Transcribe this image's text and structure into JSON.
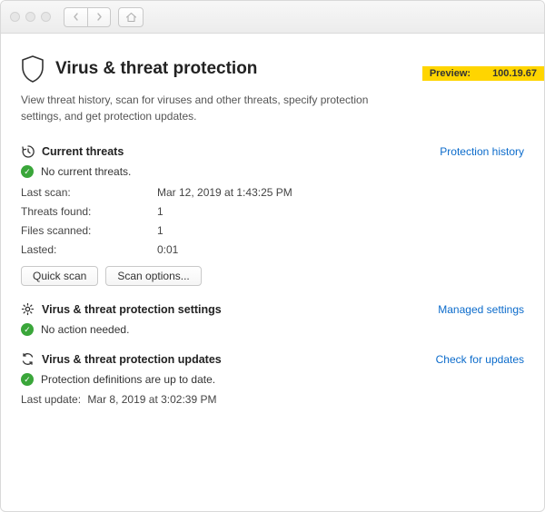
{
  "preview": {
    "label": "Preview:",
    "version": "100.19.67"
  },
  "page": {
    "title": "Virus & threat protection",
    "description": "View threat history, scan for viruses and other threats, specify protection settings, and get protection updates."
  },
  "threats": {
    "heading": "Current threats",
    "link": "Protection history",
    "status": "No current threats.",
    "rows": {
      "last_scan_label": "Last scan:",
      "last_scan_value": "Mar 12, 2019 at 1:43:25 PM",
      "threats_found_label": "Threats found:",
      "threats_found_value": "1",
      "files_scanned_label": "Files scanned:",
      "files_scanned_value": "1",
      "lasted_label": "Lasted:",
      "lasted_value": "0:01"
    },
    "buttons": {
      "quick": "Quick scan",
      "options": "Scan options..."
    }
  },
  "settings": {
    "heading": "Virus & threat protection settings",
    "link": "Managed settings",
    "status": "No action needed."
  },
  "updates": {
    "heading": "Virus & threat protection updates",
    "link": "Check for updates",
    "status": "Protection definitions are up to date.",
    "last_update_label": "Last update:",
    "last_update_value": "Mar 8, 2019 at 3:02:39 PM"
  }
}
